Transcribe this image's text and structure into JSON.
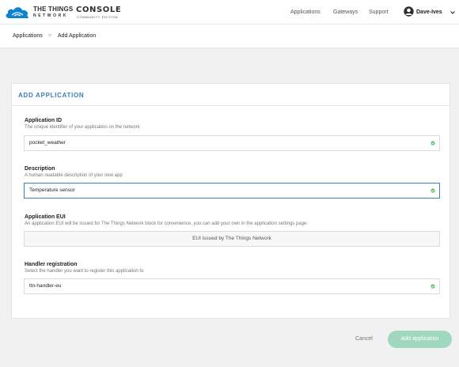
{
  "header": {
    "logo_line1": "THE THINGS",
    "logo_line2": "NETWORK",
    "logo_console": "CONSOLE",
    "logo_edition": "COMMUNITY EDITION",
    "nav": {
      "applications": "Applications",
      "gateways": "Gateways",
      "support": "Support"
    },
    "user": {
      "name": "Dave-Ives",
      "icon": "user-avatar-icon"
    },
    "brand_color": "#0d83d0"
  },
  "breadcrumb": {
    "items": [
      "Applications",
      "Add Application"
    ],
    "separator": ">"
  },
  "form": {
    "title": "ADD APPLICATION",
    "accent_color": "#3b7ec1",
    "fields": [
      {
        "label": "Application ID",
        "description": "The unique identifier of your application on the network",
        "value": "pocket_weather",
        "state": "valid"
      },
      {
        "label": "Description",
        "description": "A human readable description of your new app",
        "value": "Temperature sensor",
        "state": "focused-valid"
      },
      {
        "label": "Application EUI",
        "description": "An application EUI will be issued for The Things Network block for convenience, you can add your own in the application settings page.",
        "value": "EUI issued by The Things Network",
        "state": "disabled"
      },
      {
        "label": "Handler registration",
        "description": "Select the handler you want to register this application to",
        "value": "ttn-handler-eu",
        "state": "valid"
      }
    ],
    "valid_color": "#5ec26a"
  },
  "actions": {
    "cancel": "Cancel",
    "submit": "Add application",
    "submit_color": "#9fd8bf"
  }
}
